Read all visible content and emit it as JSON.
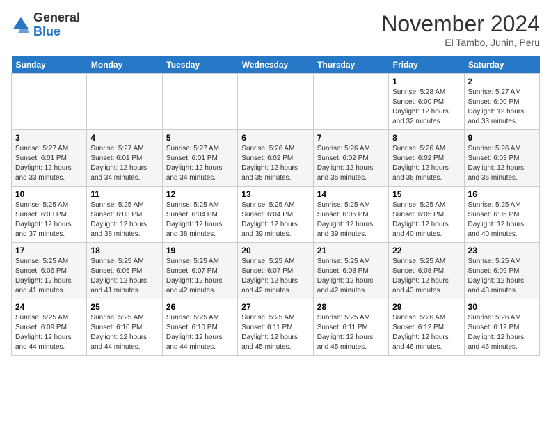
{
  "header": {
    "logo_general": "General",
    "logo_blue": "Blue",
    "month_title": "November 2024",
    "subtitle": "El Tambo, Junin, Peru"
  },
  "days_of_week": [
    "Sunday",
    "Monday",
    "Tuesday",
    "Wednesday",
    "Thursday",
    "Friday",
    "Saturday"
  ],
  "weeks": [
    [
      {
        "day": "",
        "info": ""
      },
      {
        "day": "",
        "info": ""
      },
      {
        "day": "",
        "info": ""
      },
      {
        "day": "",
        "info": ""
      },
      {
        "day": "",
        "info": ""
      },
      {
        "day": "1",
        "info": "Sunrise: 5:28 AM\nSunset: 6:00 PM\nDaylight: 12 hours and 32 minutes."
      },
      {
        "day": "2",
        "info": "Sunrise: 5:27 AM\nSunset: 6:00 PM\nDaylight: 12 hours and 33 minutes."
      }
    ],
    [
      {
        "day": "3",
        "info": "Sunrise: 5:27 AM\nSunset: 6:01 PM\nDaylight: 12 hours and 33 minutes."
      },
      {
        "day": "4",
        "info": "Sunrise: 5:27 AM\nSunset: 6:01 PM\nDaylight: 12 hours and 34 minutes."
      },
      {
        "day": "5",
        "info": "Sunrise: 5:27 AM\nSunset: 6:01 PM\nDaylight: 12 hours and 34 minutes."
      },
      {
        "day": "6",
        "info": "Sunrise: 5:26 AM\nSunset: 6:02 PM\nDaylight: 12 hours and 35 minutes."
      },
      {
        "day": "7",
        "info": "Sunrise: 5:26 AM\nSunset: 6:02 PM\nDaylight: 12 hours and 35 minutes."
      },
      {
        "day": "8",
        "info": "Sunrise: 5:26 AM\nSunset: 6:02 PM\nDaylight: 12 hours and 36 minutes."
      },
      {
        "day": "9",
        "info": "Sunrise: 5:26 AM\nSunset: 6:03 PM\nDaylight: 12 hours and 36 minutes."
      }
    ],
    [
      {
        "day": "10",
        "info": "Sunrise: 5:25 AM\nSunset: 6:03 PM\nDaylight: 12 hours and 37 minutes."
      },
      {
        "day": "11",
        "info": "Sunrise: 5:25 AM\nSunset: 6:03 PM\nDaylight: 12 hours and 38 minutes."
      },
      {
        "day": "12",
        "info": "Sunrise: 5:25 AM\nSunset: 6:04 PM\nDaylight: 12 hours and 38 minutes."
      },
      {
        "day": "13",
        "info": "Sunrise: 5:25 AM\nSunset: 6:04 PM\nDaylight: 12 hours and 39 minutes."
      },
      {
        "day": "14",
        "info": "Sunrise: 5:25 AM\nSunset: 6:05 PM\nDaylight: 12 hours and 39 minutes."
      },
      {
        "day": "15",
        "info": "Sunrise: 5:25 AM\nSunset: 6:05 PM\nDaylight: 12 hours and 40 minutes."
      },
      {
        "day": "16",
        "info": "Sunrise: 5:25 AM\nSunset: 6:05 PM\nDaylight: 12 hours and 40 minutes."
      }
    ],
    [
      {
        "day": "17",
        "info": "Sunrise: 5:25 AM\nSunset: 6:06 PM\nDaylight: 12 hours and 41 minutes."
      },
      {
        "day": "18",
        "info": "Sunrise: 5:25 AM\nSunset: 6:06 PM\nDaylight: 12 hours and 41 minutes."
      },
      {
        "day": "19",
        "info": "Sunrise: 5:25 AM\nSunset: 6:07 PM\nDaylight: 12 hours and 42 minutes."
      },
      {
        "day": "20",
        "info": "Sunrise: 5:25 AM\nSunset: 6:07 PM\nDaylight: 12 hours and 42 minutes."
      },
      {
        "day": "21",
        "info": "Sunrise: 5:25 AM\nSunset: 6:08 PM\nDaylight: 12 hours and 42 minutes."
      },
      {
        "day": "22",
        "info": "Sunrise: 5:25 AM\nSunset: 6:08 PM\nDaylight: 12 hours and 43 minutes."
      },
      {
        "day": "23",
        "info": "Sunrise: 5:25 AM\nSunset: 6:09 PM\nDaylight: 12 hours and 43 minutes."
      }
    ],
    [
      {
        "day": "24",
        "info": "Sunrise: 5:25 AM\nSunset: 6:09 PM\nDaylight: 12 hours and 44 minutes."
      },
      {
        "day": "25",
        "info": "Sunrise: 5:25 AM\nSunset: 6:10 PM\nDaylight: 12 hours and 44 minutes."
      },
      {
        "day": "26",
        "info": "Sunrise: 5:25 AM\nSunset: 6:10 PM\nDaylight: 12 hours and 44 minutes."
      },
      {
        "day": "27",
        "info": "Sunrise: 5:25 AM\nSunset: 6:11 PM\nDaylight: 12 hours and 45 minutes."
      },
      {
        "day": "28",
        "info": "Sunrise: 5:25 AM\nSunset: 6:11 PM\nDaylight: 12 hours and 45 minutes."
      },
      {
        "day": "29",
        "info": "Sunrise: 5:26 AM\nSunset: 6:12 PM\nDaylight: 12 hours and 46 minutes."
      },
      {
        "day": "30",
        "info": "Sunrise: 5:26 AM\nSunset: 6:12 PM\nDaylight: 12 hours and 46 minutes."
      }
    ]
  ]
}
